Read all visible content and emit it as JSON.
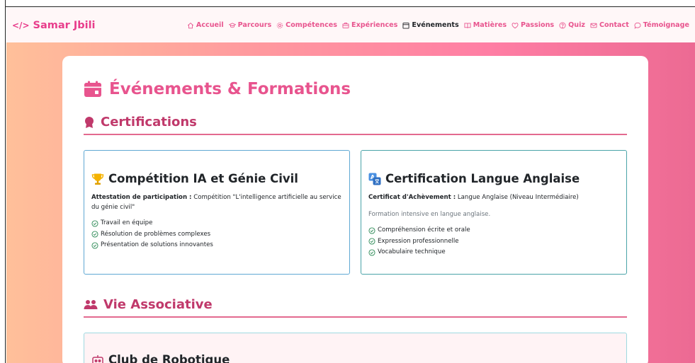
{
  "brand": {
    "name": "Samar Jbili",
    "glyph": "</>"
  },
  "nav": {
    "items": [
      {
        "label": "Accueil",
        "icon": "house-icon"
      },
      {
        "label": "Parcours",
        "icon": "graduation-cap-icon"
      },
      {
        "label": "Compétences",
        "icon": "gear-icon"
      },
      {
        "label": "Expériences",
        "icon": "briefcase-icon"
      },
      {
        "label": "Evénements",
        "icon": "calendar-icon",
        "active": true
      },
      {
        "label": "Matières",
        "icon": "book-icon"
      },
      {
        "label": "Passions",
        "icon": "heart-icon"
      },
      {
        "label": "Quiz",
        "icon": "question-circle-icon"
      },
      {
        "label": "Contact",
        "icon": "envelope-icon"
      },
      {
        "label": "Témoignage",
        "icon": "chat-icon"
      }
    ]
  },
  "page": {
    "title": "Événements & Formations"
  },
  "sections": {
    "certifications": {
      "title": "Certifications"
    },
    "associative": {
      "title": "Vie Associative"
    }
  },
  "certs": [
    {
      "title": "Compétition IA et Génie Civil",
      "icon": "trophy-icon",
      "label": "Attestation de participation :",
      "value": "Compétition \"L'intelligence artificielle au service du génie civil\"",
      "description": "",
      "points": [
        "Travail en équipe",
        "Résolution de problèmes complexes",
        "Présentation de solutions innovantes"
      ]
    },
    {
      "title": "Certification Langue Anglaise",
      "icon": "translate-icon",
      "label": "Certificat d'Achèvement :",
      "value": "Langue Anglaise (Niveau Intermédiaire)",
      "description": "Formation intensive en langue anglaise.",
      "points": [
        "Compréhension écrite et orale",
        "Expression professionnelle",
        "Vocabulaire technique"
      ]
    }
  ],
  "associative": [
    {
      "title": "Club de Robotique",
      "icon": "robot-icon"
    }
  ],
  "colors": {
    "accent": "#e8548e",
    "section": "#c0396b",
    "active_nav": "#212529"
  }
}
